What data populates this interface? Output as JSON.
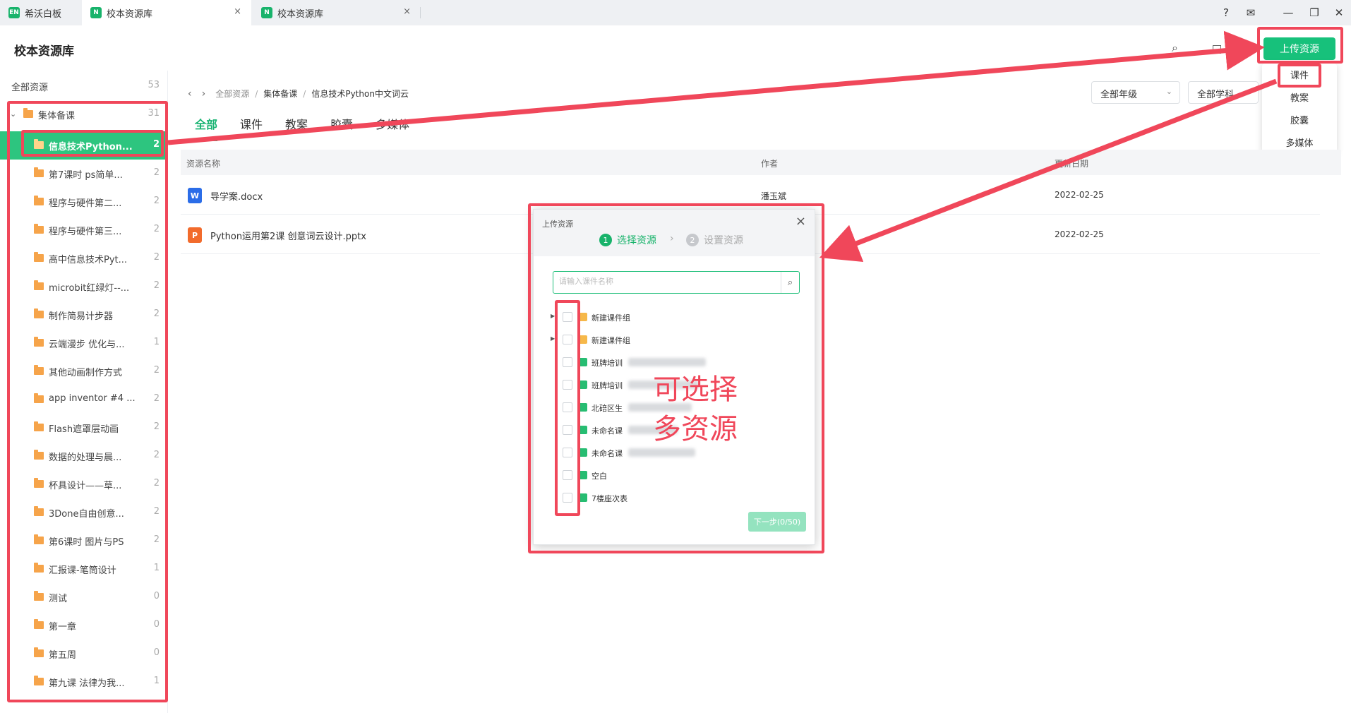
{
  "window": {
    "tabs": [
      {
        "icon": "EN",
        "title": "希沃白板"
      },
      {
        "icon": "N",
        "title": "校本资源库"
      },
      {
        "icon": "N",
        "title": "校本资源库"
      }
    ],
    "close_glyph": "×",
    "controls": {
      "help": "?",
      "mail": "✉",
      "minimize": "—",
      "restore": "❐",
      "close": "✕"
    }
  },
  "header": {
    "title": "校本资源库",
    "records_label": "记录",
    "upload_button": "上传资源",
    "upload_menu": [
      "课件",
      "教案",
      "胶囊",
      "多媒体"
    ]
  },
  "sidebar": {
    "all": {
      "label": "全部资源",
      "count": "53"
    },
    "group": {
      "label": "集体备课",
      "count": "31"
    },
    "items": [
      {
        "label": "信息技术Python...",
        "count": "2",
        "active": true
      },
      {
        "label": "第7课时 ps简单...",
        "count": "2"
      },
      {
        "label": "程序与硬件第二...",
        "count": "2"
      },
      {
        "label": "程序与硬件第三...",
        "count": "2"
      },
      {
        "label": "高中信息技术Pyt...",
        "count": "2"
      },
      {
        "label": "microbit红绿灯--...",
        "count": "2"
      },
      {
        "label": "制作简易计步器",
        "count": "2"
      },
      {
        "label": "云端漫步 优化与...",
        "count": "1"
      },
      {
        "label": "其他动画制作方式",
        "count": "2"
      },
      {
        "label": "app inventor #4 ...",
        "count": "2"
      },
      {
        "label": "Flash遮罩层动画",
        "count": "2"
      },
      {
        "label": "数据的处理与晨...",
        "count": "2"
      },
      {
        "label": "杯具设计——草...",
        "count": "2"
      },
      {
        "label": "3Done自由创意...",
        "count": "2"
      },
      {
        "label": "第6课时 图片与PS",
        "count": "2"
      },
      {
        "label": "汇报课-笔筒设计",
        "count": "1"
      },
      {
        "label": "测试",
        "count": "0"
      },
      {
        "label": "第一章",
        "count": "0"
      },
      {
        "label": "第五周",
        "count": "0"
      },
      {
        "label": "第九课 法律为我...",
        "count": "1"
      }
    ]
  },
  "breadcrumb": {
    "root": "全部资源",
    "group": "集体备课",
    "current": "信息技术Python中文词云"
  },
  "filters": {
    "grade": "全部年级",
    "subject": "全部学科"
  },
  "tabs": [
    "全部",
    "课件",
    "教案",
    "胶囊",
    "多媒体"
  ],
  "table": {
    "headers": {
      "name": "资源名称",
      "author": "作者",
      "date": "更新日期"
    },
    "rows": [
      {
        "icon": "W",
        "icon_color": "#2b6de8",
        "name": "导学案.docx",
        "author": "潘玉斌",
        "date": "2022-02-25"
      },
      {
        "icon": "P",
        "icon_color": "#f26b2c",
        "name": "Python运用第2课 创意词云设计.pptx",
        "author": "",
        "date": "2022-02-25"
      }
    ]
  },
  "dialog": {
    "title": "上传资源",
    "step1": {
      "num": "1",
      "label": "选择资源"
    },
    "step2": {
      "num": "2",
      "label": "设置资源"
    },
    "search_placeholder": "请输入课件名称",
    "items": [
      {
        "label": "新建课件组",
        "type": "folder"
      },
      {
        "label": "新建课件组",
        "type": "folder"
      },
      {
        "label": "班牌培训",
        "type": "file"
      },
      {
        "label": "班牌培训",
        "type": "file"
      },
      {
        "label": "北碚区生",
        "type": "file"
      },
      {
        "label": "未命名课",
        "type": "file"
      },
      {
        "label": "未命名课",
        "type": "file"
      },
      {
        "label": "空白",
        "type": "file"
      },
      {
        "label": "7楼座次表",
        "type": "file"
      }
    ],
    "next_button": "下一步(0/50)"
  },
  "annotation": {
    "line1": "可选择",
    "line2": "多资源"
  },
  "colors": {
    "accent": "#17c17b",
    "annotation": "#f0475a",
    "folder": "#f6a44a"
  }
}
